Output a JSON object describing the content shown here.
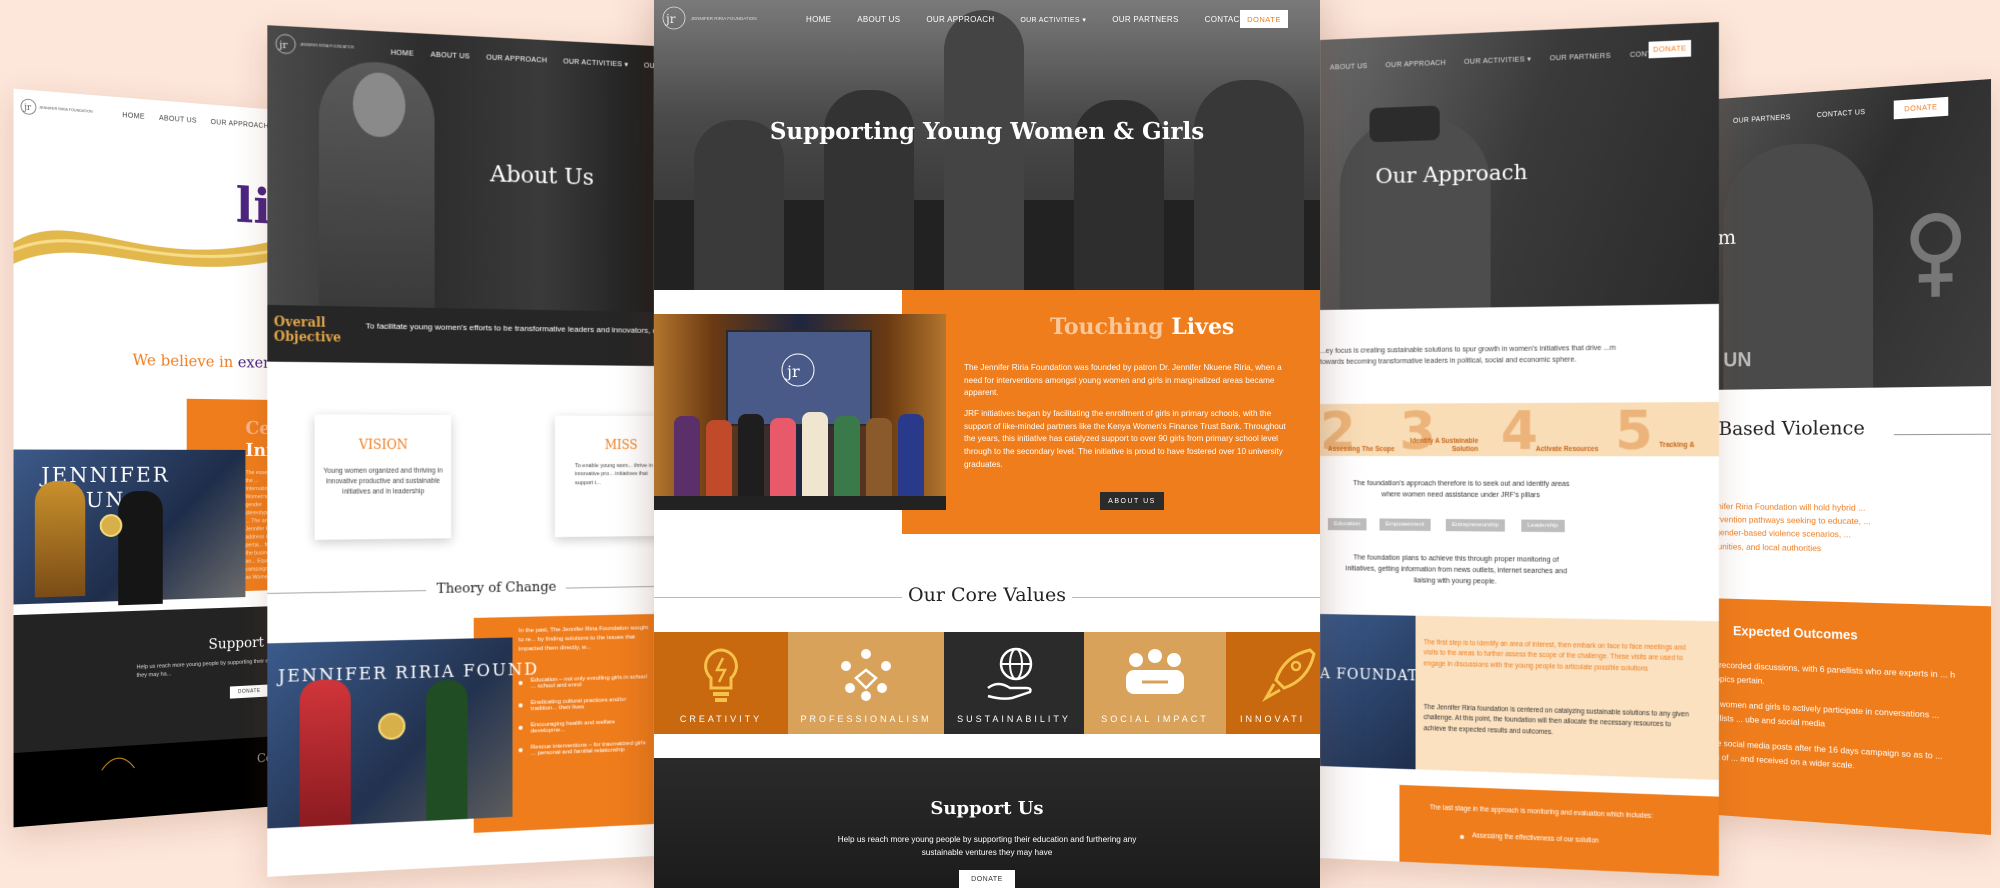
{
  "brand": {
    "name": "JENNIFER RIRIA FOUNDATION",
    "monogram": "jrf"
  },
  "colors": {
    "accent": "#f07d1c",
    "background": "#fde6da",
    "dark": "#2b2b2b",
    "gold": "#e2a64a"
  },
  "nav": {
    "home": "HOME",
    "about": "ABOUT US",
    "approach": "OUR APPROACH",
    "activities": "OUR ACTIVITIES",
    "partners": "OUR PARTNERS",
    "contact": "CONTACT US",
    "donate": "DONATE"
  },
  "p1": {
    "hero_word": "lio",
    "tagline_pre": "We believe in",
    "tagline_post": "exemplary y",
    "card_title1": "Celebr",
    "card_title2": "Innova",
    "card_body": "The essence of the ... International Women's ... gender stereotypes and ... The annual Jennifer Ri... address issues pertai... from the business an... Equity campaign by ... as Women.",
    "support_title": "Support Us",
    "support_body": "Help us reach more young people by supporting their ed... sustainable ventures they may ha...",
    "donate": "DONATE",
    "footer_partial": "Co"
  },
  "p2": {
    "title": "About Us",
    "objective_label1": "Overall",
    "objective_label2": "Objective",
    "objective_text": "To facilitate young women's efforts to be transformative leaders and innovators, capabl",
    "vision_title": "VISION",
    "vision_body": "Young women organized and thriving in innovative productive and sustainable initiatives and in leadership",
    "mission_title": "MISS",
    "mission_body": "To enable young wom... thrive in innovative pro... initiatives that support t...",
    "theory": "Theory of Change",
    "change_intro": "In the past, The Jennifer Riria Foundation sought to re... by finding solutions to the issues that impacted them directly, w...",
    "change_items": [
      "Education – not only enrolling girls in school ... school and enrol",
      "Eradicating cultural practices and/or tradition... their lives",
      "Encouraging health and welfare developme...",
      "Rescue interventions – for traumatized girls ... personal and familial relationship"
    ]
  },
  "p3": {
    "hero_title": "Supporting Young Women & Girls",
    "touching": "Touching",
    "lives": "Lives",
    "para1": "The Jennifer Riria Foundation was founded by patron Dr. Jennifer Nkuene Riria, when a need for interventions amongst young women and girls in marginalized areas became apparent.",
    "para2": "JRF initiatives began by facilitating the enrollment of girls in primary schools, with the support of like-minded partners like the Kenya Women's Finance Trust Bank. Throughout the years, this initiative has catalyzed support to over 90 girls from primary school level through to the secondary level. The initiative is proud to have fostered over 10 university graduates.",
    "about_btn": "ABOUT US",
    "core_values": "Our Core Values",
    "values": [
      "CREATIVITY",
      "PROFESSIONALISM",
      "SUSTAINABILITY",
      "SOCIAL IMPACT",
      "INNOVATI"
    ],
    "support_title": "Support Us",
    "support_body": "Help us reach more young people by supporting their education and furthering any sustainable ventures they may have",
    "donate": "DONATE"
  },
  "p4": {
    "title": "Our Approach",
    "intro": "...ey focus is creating sustainable solutions to spur growth in women's initiatives that drive ...m towards becoming transformative leaders in political, social and economic sphere.",
    "steps": [
      {
        "n": "2",
        "label": "Assessing The Scope"
      },
      {
        "n": "3",
        "label": "Identify A Sustainable Solution"
      },
      {
        "n": "4",
        "label": "Activate Resources"
      },
      {
        "n": "5",
        "label": "Tracking &"
      }
    ],
    "seek": "The foundation's approach therefore is to seek out and identify areas where women need assistance under JRF's pillars",
    "chips": [
      "Education",
      "Empowerment",
      "Entrepreneurship",
      "Leadership"
    ],
    "monitor": "The foundation plans to achieve this through proper monitoring of initiatives, getting information from news outlets, internet searches and liaising with young people.",
    "step1": "The first step is to identify an area of interest, then embark on face to face meetings and visits to the areas to further assess the scope of the challenge. These visits are used to engage in discussions with the young people to articulate possible solutions",
    "centered": "The Jennifer Riria foundation is centered on catalyzing sustainable solutions to any given challenge. At this point, the foundation will then allocate the necessary resources to achieve the expected results and outcomes.",
    "last_stage": "The last stage in the approach is monitoring and evaluation which includes:",
    "last_item": "Assessing the effectiveness of our solution",
    "banner_text": "A FOUNDATIO"
  },
  "p5": {
    "hero_partial": "sm",
    "gbv_title1": "r Based Violence",
    "gbv_title2": "h",
    "gbv_body": "Jennifer Riria Foundation will hold hybrid ... intervention pathways seeking to educate, ... ng gender-based violence scenarios, ... mmunities, and local authorities",
    "outcomes_title": "Expected Outcomes",
    "outcomes": [
      "sful recorded discussions, with 6 panellists who are experts in ... h ... topics pertain.",
      "100 women and girls to actively participate in conversations ... anellists ... ube and social media",
      "ative social media posts after the 16 days campaign so as to ... thos of ... and received on a wider scale."
    ],
    "un": "UN"
  }
}
